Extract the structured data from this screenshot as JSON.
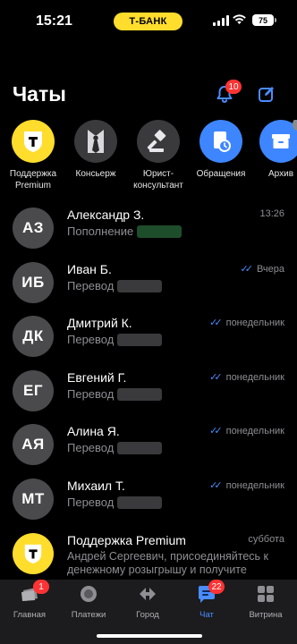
{
  "status_bar": {
    "time": "15:21",
    "bank": "Т-БАНК",
    "battery": "75"
  },
  "header": {
    "title": "Чаты",
    "notifications_count": "10"
  },
  "stories": [
    {
      "label": "Поддержка\nPremium",
      "color": "#ffdd2d",
      "icon": "tbank-shield-icon"
    },
    {
      "label": "Консьерж",
      "color": "#3a3a3c",
      "icon": "tie-icon"
    },
    {
      "label": "Юрист-\nконсультант",
      "color": "#3a3a3c",
      "icon": "gavel-icon"
    },
    {
      "label": "Обращения",
      "color": "#3d86ff",
      "icon": "document-clock-icon"
    },
    {
      "label": "Архив",
      "color": "#3d86ff",
      "icon": "archive-icon",
      "badge": "4"
    }
  ],
  "chats": [
    {
      "initials": "АЗ",
      "name": "Александр З.",
      "time": "13:26",
      "preview": "Пополнение",
      "read": false,
      "blur": "green"
    },
    {
      "initials": "ИБ",
      "name": "Иван Б.",
      "time": "Вчера",
      "preview": "Перевод",
      "read": true
    },
    {
      "initials": "ДК",
      "name": "Дмитрий К.",
      "time": "понедельник",
      "preview": "Перевод",
      "read": true
    },
    {
      "initials": "ЕГ",
      "name": "Евгений Г.",
      "time": "понедельник",
      "preview": "Перевод",
      "read": true
    },
    {
      "initials": "АЯ",
      "name": "Алина Я.",
      "time": "понедельник",
      "preview": "Перевод",
      "read": true
    },
    {
      "initials": "МТ",
      "name": "Михаил Т.",
      "time": "понедельник",
      "preview": "Перевод",
      "read": true
    }
  ],
  "support_chat": {
    "name": "Поддержка Premium",
    "time": "суббота",
    "preview": "Андрей Сергеевич, присоединяйтесь к денежному розыгрышу и получите"
  },
  "tabs": [
    {
      "label": "Главная",
      "icon": "home-card-icon",
      "badge": "1",
      "active": false
    },
    {
      "label": "Платежи",
      "icon": "payments-icon",
      "active": false
    },
    {
      "label": "Город",
      "icon": "city-icon",
      "active": false
    },
    {
      "label": "Чат",
      "icon": "chat-icon",
      "badge": "22",
      "active": true
    },
    {
      "label": "Витрина",
      "icon": "showcase-icon",
      "active": false
    }
  ],
  "colors": {
    "accent": "#4a8dff",
    "brand_yellow": "#ffdd2d",
    "badge_red": "#ff3333"
  }
}
